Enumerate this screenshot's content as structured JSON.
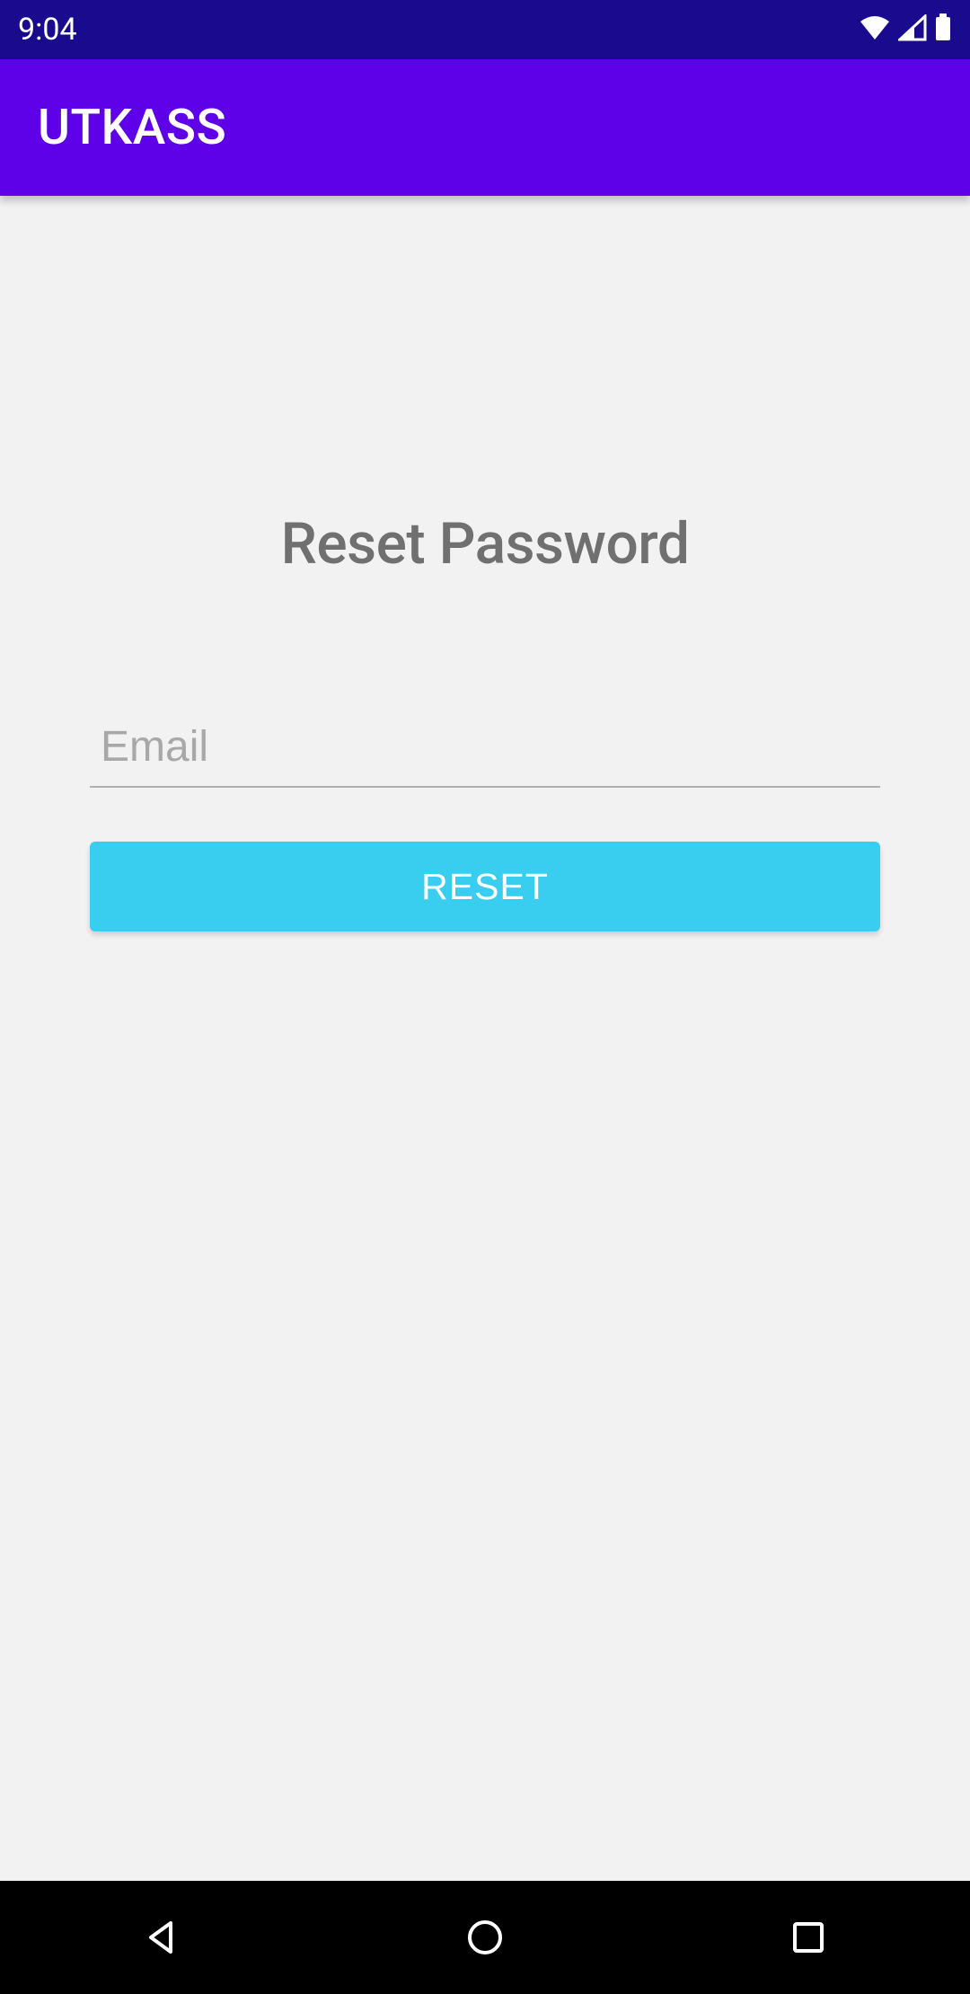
{
  "status": {
    "time": "9:04"
  },
  "app": {
    "title": "UTKASS"
  },
  "page": {
    "heading": "Reset Password"
  },
  "form": {
    "email_placeholder": "Email",
    "email_value": "",
    "reset_label": "RESET"
  },
  "colors": {
    "status_bar": "#1a0b8e",
    "app_bar": "#5e01e9",
    "button": "#39ceef",
    "background": "#f2f2f2"
  }
}
